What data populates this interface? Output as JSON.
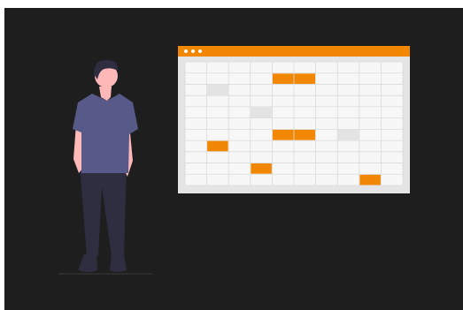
{
  "illustration": {
    "theme": "calendar-schedule",
    "colors": {
      "background": "#1e1e1e",
      "accent": "#f28705",
      "window": "#e5e5e5",
      "cell": "#f7f7f7",
      "cell_muted": "#e3e3e3",
      "gridline": "#dadada"
    },
    "calendar": {
      "columns": 10,
      "rows": 11,
      "highlighted_cells": [
        {
          "row": 1,
          "col": 4,
          "span": 2,
          "color": "accent"
        },
        {
          "row": 2,
          "col": 1,
          "span": 1,
          "color": "muted"
        },
        {
          "row": 4,
          "col": 3,
          "span": 1,
          "color": "muted"
        },
        {
          "row": 6,
          "col": 4,
          "span": 2,
          "color": "accent"
        },
        {
          "row": 6,
          "col": 7,
          "span": 1,
          "color": "muted"
        },
        {
          "row": 7,
          "col": 1,
          "span": 1,
          "color": "accent"
        },
        {
          "row": 9,
          "col": 3,
          "span": 1,
          "color": "accent"
        },
        {
          "row": 10,
          "col": 8,
          "span": 1,
          "color": "accent"
        }
      ]
    },
    "person": {
      "shirt_color": "#575a89",
      "pants_color": "#2f2e41",
      "skin_color": "#ffb8b8",
      "hair_color": "#2f2e41"
    }
  }
}
